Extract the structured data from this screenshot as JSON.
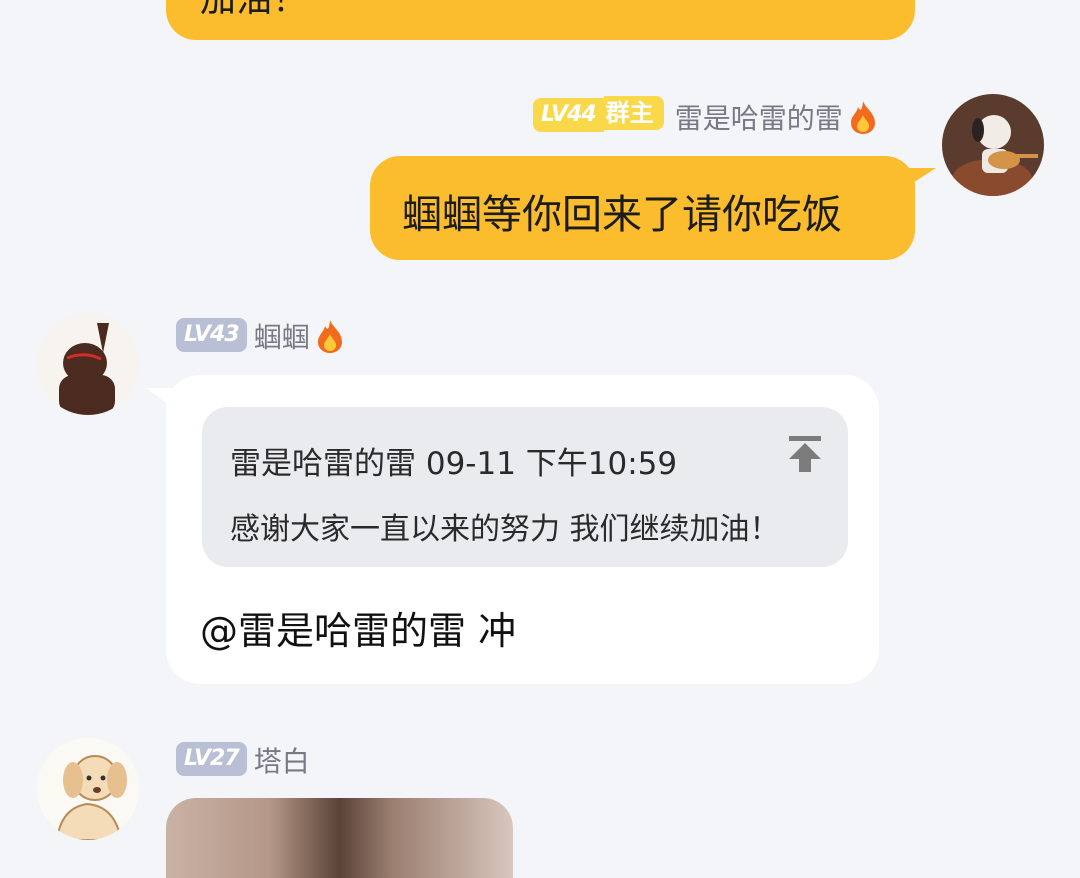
{
  "previous_message": {
    "text": "加油！"
  },
  "message_self": {
    "level": "LV44",
    "role_badge": "群主",
    "nickname": "雷是哈雷的雷",
    "fire_icon": "fire-icon",
    "text": "蝈蝈等你回来了请你吃饭"
  },
  "message_reply": {
    "level": "LV43",
    "nickname": "蝈蝈",
    "fire_icon": "fire-icon",
    "quote": {
      "author": "雷是哈雷的雷",
      "time": "09-11 下午10:59",
      "text": "感谢大家一直以来的努力 我们继续加油！",
      "pin_icon": "pin-top-icon"
    },
    "text": "@雷是哈雷的雷 冲"
  },
  "message_next": {
    "level": "LV27",
    "nickname": "塔白"
  },
  "colors": {
    "bubble_self": "#fbbd2e",
    "bubble_other": "#ffffff",
    "background": "#f4f5f9",
    "badge_level": "#b9bfd4",
    "badge_owner": "#f9d84a"
  }
}
